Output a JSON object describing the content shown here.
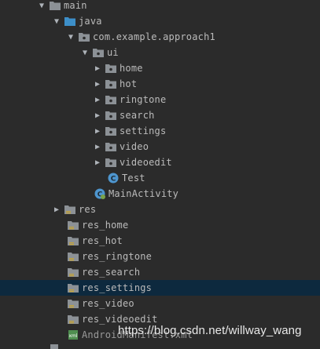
{
  "tree": {
    "main": "main",
    "java": "java",
    "package": "com.example.approach1",
    "ui": "ui",
    "ui_children": [
      "home",
      "hot",
      "ringtone",
      "search",
      "settings",
      "video",
      "videoedit"
    ],
    "test_class": "Test",
    "main_activity": "MainActivity",
    "res": "res",
    "res_folders": [
      "res_home",
      "res_hot",
      "res_ringtone",
      "res_search",
      "res_settings",
      "res_video",
      "res_videoedit"
    ],
    "manifest": "AndroidManifest.xml"
  },
  "colors": {
    "background": "#2b2b2b",
    "selection": "#0d293e",
    "folder_gray": "#8c9196",
    "folder_blue": "#3d8fc9",
    "class_blue": "#4e96cf",
    "res_bars": "#c2a33c",
    "manifest_green": "#4f8f50"
  },
  "watermark": "https://blog.csdn.net/willway_wang"
}
